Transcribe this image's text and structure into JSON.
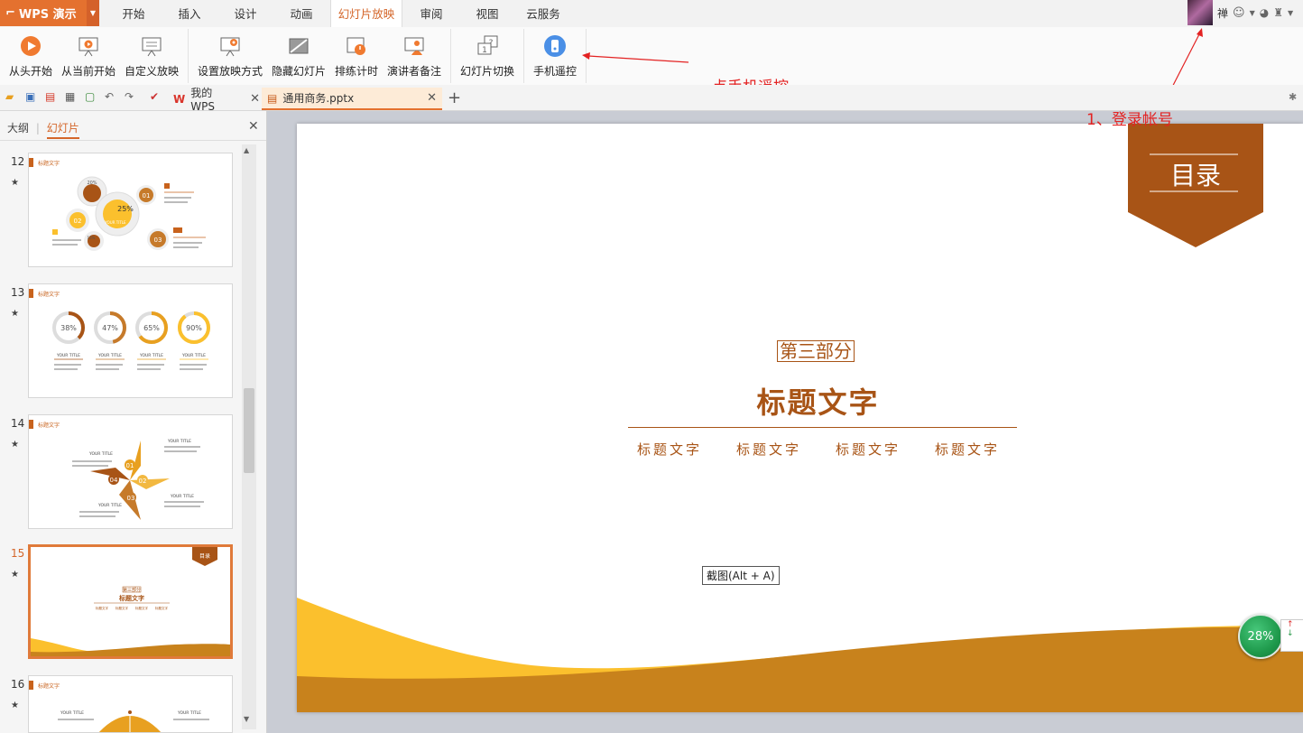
{
  "app": {
    "name": "WPS 演示"
  },
  "menu": {
    "tabs": [
      "开始",
      "插入",
      "设计",
      "动画",
      "幻灯片放映",
      "审阅",
      "视图",
      "云服务"
    ],
    "active_index": 4
  },
  "user": {
    "name_char": "禅"
  },
  "ribbon": {
    "buttons": [
      "从头开始",
      "从当前开始",
      "自定义放映",
      "设置放映方式",
      "隐藏幻灯片",
      "排练计时",
      "演讲者备注",
      "幻灯片切换",
      "手机遥控"
    ]
  },
  "annotations": {
    "remote_hint": "点手机遥控",
    "login_hint": "1、登录帐号"
  },
  "doc_tabs": {
    "wps_home": "我的WPS",
    "file": "通用商务.pptx"
  },
  "side_panel": {
    "tabs": [
      "大纲",
      "幻灯片"
    ],
    "active_tab": "幻灯片",
    "slide_numbers": [
      "12",
      "13",
      "14",
      "15",
      "16"
    ],
    "selected": "15",
    "thumb_header": "标题文字",
    "thumb12": {
      "pct_big": "25%",
      "pct_small": "20%",
      "pct_small2": "15%",
      "nums": [
        "01",
        "02",
        "03"
      ],
      "center": "YOUR TITLE"
    },
    "thumb13": {
      "pcts": [
        "38%",
        "47%",
        "65%",
        "90%"
      ],
      "label": "YOUR TITLE"
    },
    "thumb14": {
      "nums": [
        "01",
        "02",
        "03",
        "04"
      ],
      "label": "YOUR TITLE"
    },
    "thumb15": {
      "badge": "目录",
      "part": "第三部分",
      "title": "标题文字",
      "sub": "标题文字"
    },
    "thumb16": {
      "label": "YOUR TITLE"
    }
  },
  "slide": {
    "badge": "目录",
    "part": "第三部分",
    "title": "标题文字",
    "subtitles": [
      "标题文字",
      "标题文字",
      "标题文字",
      "标题文字"
    ],
    "screenshot_tip": "截图(Alt + A)"
  },
  "widget": {
    "percent": "28%"
  },
  "colors": {
    "accent_orange": "#e4712f",
    "brown": "#a85416",
    "gold": "#fbc02d",
    "annotation_red": "#e32222",
    "widget_green": "#1f9a4c"
  }
}
